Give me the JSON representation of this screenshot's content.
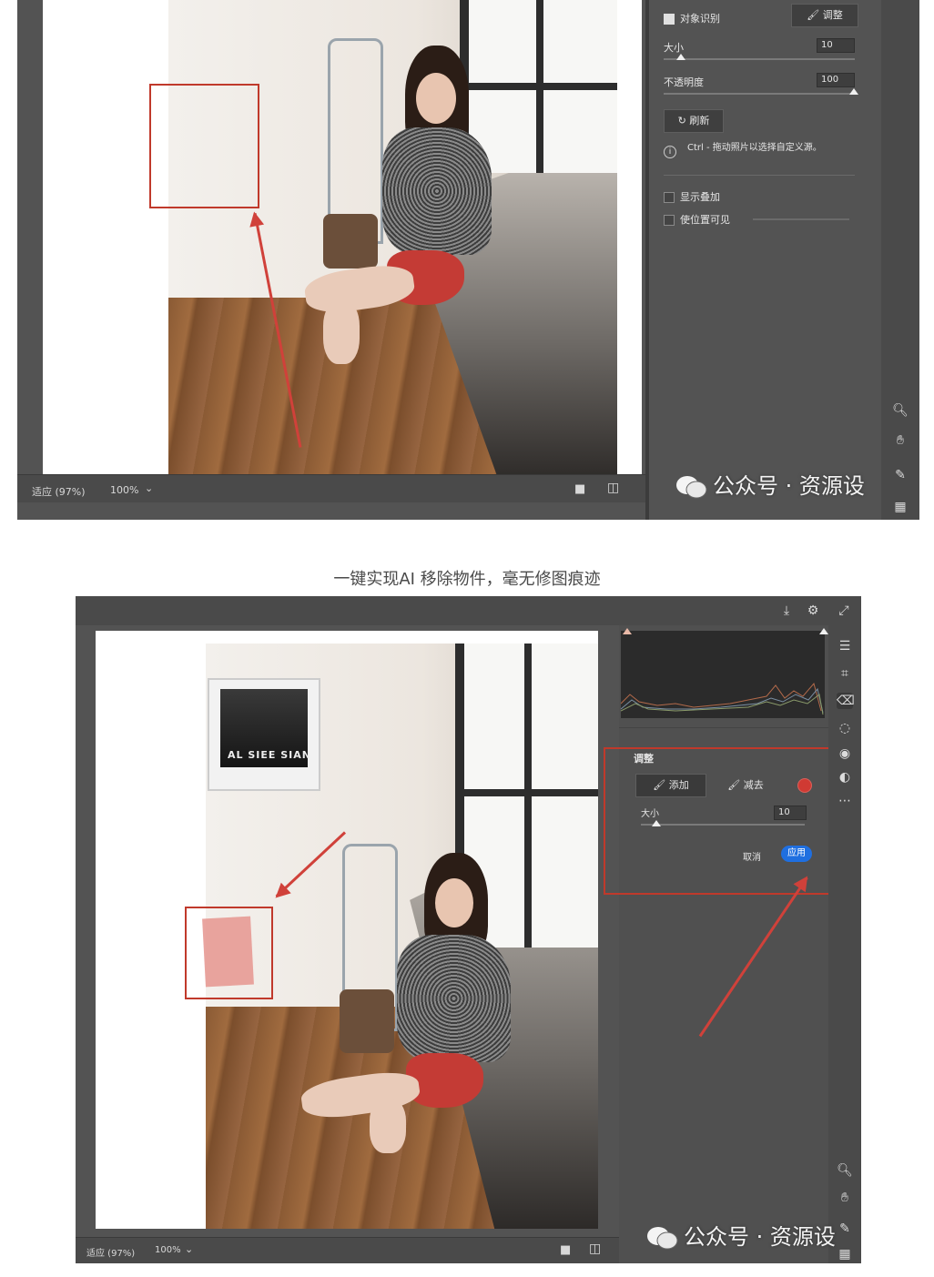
{
  "caption": "一键实现AI 移除物件，毫无修图痕迹",
  "watermark": {
    "text": "公众号 · 资源设",
    "icon": "wechat-icon"
  },
  "shot1": {
    "panel": {
      "object_detect_label": "对象识别",
      "object_detect_checked": true,
      "adjust_button": "调整",
      "size_label": "大小",
      "size_value": "10",
      "opacity_label": "不透明度",
      "opacity_value": "100",
      "refresh_button": "刷新",
      "info_text": "Ctrl - 拖动照片以选择自定义源。",
      "show_overlay_label": "显示叠加",
      "show_position_label": "使位置可见"
    },
    "status": {
      "fit_label": "适应 (97%)",
      "zoom_label": "100%"
    },
    "right_icons": [
      "zoom-icon",
      "hand-icon",
      "eyedropper-icon",
      "grid-icon"
    ]
  },
  "shot2": {
    "top_icons": [
      "export-icon",
      "gear-icon",
      "expand-icon"
    ],
    "tool_icons": [
      "sliders-icon",
      "crop-icon",
      "eraser-icon",
      "heal-icon",
      "eye-icon",
      "mask-icon",
      "more-icon"
    ],
    "poster_text": "AL SIEE SIAN",
    "panel": {
      "title": "调整",
      "add_button": "添加",
      "subtract_button": "减去",
      "size_label": "大小",
      "size_value": "10",
      "cancel_button": "取消",
      "apply_button": "应用"
    },
    "status": {
      "fit_label": "适应 (97%)",
      "zoom_label": "100%"
    },
    "right_icons": [
      "zoom-icon",
      "hand-icon",
      "eyedropper-icon",
      "grid-icon"
    ]
  },
  "colors": {
    "accent_red": "#c0392b",
    "apply_blue": "#1f6fe0",
    "panel_bg": "#535353"
  }
}
